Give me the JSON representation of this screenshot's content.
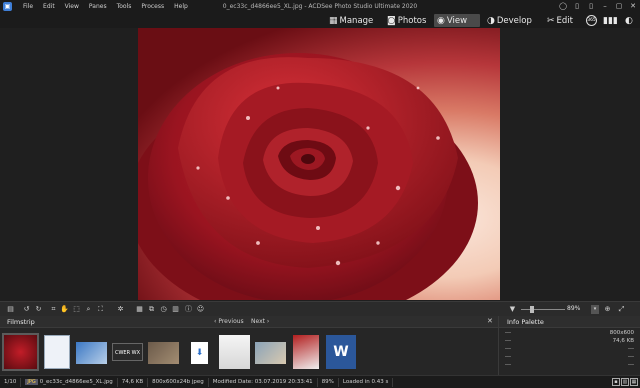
{
  "menu": [
    "File",
    "Edit",
    "View",
    "Panes",
    "Tools",
    "Process",
    "Help"
  ],
  "window": {
    "title": "0_ec33c_d4866ee5_XL.jpg - ACDSee Photo Studio Ultimate 2020"
  },
  "modes": [
    {
      "label": "Manage",
      "icon": "grid-icon"
    },
    {
      "label": "Photos",
      "icon": "photos-icon"
    },
    {
      "label": "View",
      "icon": "eye-icon",
      "active": true
    },
    {
      "label": "Develop",
      "icon": "develop-icon"
    },
    {
      "label": "Edit",
      "icon": "edit-icon"
    }
  ],
  "mode_badge": "365",
  "filmstrip": {
    "title": "Filmstrip",
    "prev": "Previous",
    "next": "Next",
    "thumb_texts": [
      "CWER WX"
    ]
  },
  "zoom": {
    "value": "89%",
    "level": 0.23
  },
  "info_palette": {
    "title": "Info Palette",
    "rows": [
      {
        "left": "---",
        "right": "800x600"
      },
      {
        "left": "---",
        "right": "74,6 KB"
      },
      {
        "left": "---",
        "right": "---"
      },
      {
        "left": "---",
        "right": "---"
      },
      {
        "left": "---",
        "right": "---"
      }
    ]
  },
  "status": {
    "position": "1/10",
    "type": "JPG",
    "filename": "0_ec33c_d4866ee5_XL.jpg",
    "size": "74,6 KB",
    "dims": "800x600x24b jpeg",
    "modified": "Modified Date: 03.07.2019 20:33:41",
    "zoom": "89%",
    "loaded": "Loaded in 0.43 s"
  },
  "colors": {
    "accent": "#3f7fd8",
    "rose": "#a3161f",
    "background": "#1e1e1e"
  }
}
